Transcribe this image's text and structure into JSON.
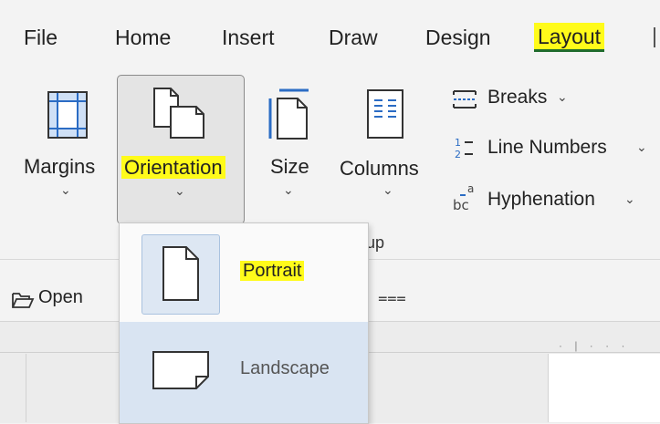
{
  "tabs": [
    {
      "label": "File"
    },
    {
      "label": "Home"
    },
    {
      "label": "Insert"
    },
    {
      "label": "Draw"
    },
    {
      "label": "Design"
    },
    {
      "label": "Layout",
      "active": true
    }
  ],
  "ribbon": {
    "margins_label": "Margins",
    "orientation_label": "Orientation",
    "size_label": "Size",
    "columns_label": "Columns",
    "breaks_label": "Breaks",
    "line_numbers_label": "Line Numbers",
    "hyphenation_label": "Hyphenation",
    "group_label_fragment": "up"
  },
  "toolbar": {
    "open_label": "Open",
    "customize_glyph": "⩶"
  },
  "dropdown": {
    "portrait_label": "Portrait",
    "landscape_label": "Landscape"
  },
  "colors": {
    "highlight": "#fffb1a",
    "tab_underline": "#1f6b2d",
    "icon_blue": "#2b6cc4",
    "selection_fill": "#d9e4f2"
  },
  "icons": {
    "margins": "margins-icon",
    "orientation": "orientation-icon",
    "size": "size-icon",
    "columns": "columns-icon",
    "breaks": "breaks-icon",
    "line_numbers": "line-numbers-icon",
    "hyphenation": "hyphenation-icon",
    "open": "folder-open-icon",
    "portrait": "portrait-page-icon",
    "landscape": "landscape-page-icon"
  }
}
